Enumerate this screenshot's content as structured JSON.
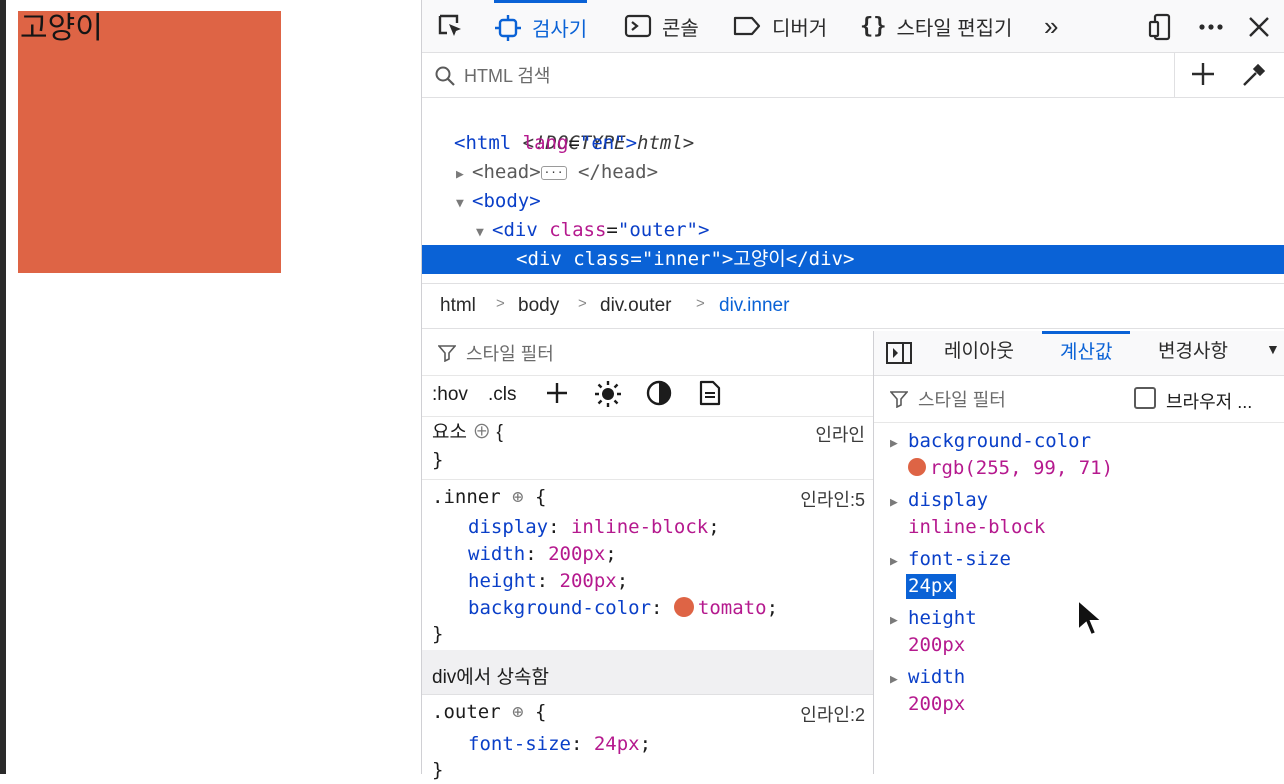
{
  "page": {
    "inner_text": "고양이",
    "inner_color": "#de6445"
  },
  "toolbar": {
    "tabs": [
      {
        "label": "검사기",
        "icon": "inspector-icon",
        "active": true
      },
      {
        "label": "콘솔",
        "icon": "console-icon"
      },
      {
        "label": "디버거",
        "icon": "debugger-icon"
      },
      {
        "label": "스타일 편집기",
        "icon": "style-editor-icon"
      }
    ],
    "more_tools": "»",
    "accent": "#0a62d6"
  },
  "search": {
    "placeholder": "HTML 검색"
  },
  "markup": {
    "doctype": "<!DOCTYPE html>",
    "html_open": "<html",
    "html_attr": "lang",
    "html_val": "\"en\"",
    "head_open": "<head>",
    "head_close": "</head>",
    "body_open": "<body>",
    "outer_div": "<div",
    "outer_attr": "class",
    "outer_val": "\"outer\"",
    "inner_line": "<div class=\"inner\">고양이</div>"
  },
  "breadcrumb": [
    "html",
    "body",
    "div.outer",
    "div.inner"
  ],
  "rules": {
    "filter_placeholder": "스타일 필터",
    "tools": [
      ":hov",
      ".cls"
    ],
    "element_rule": {
      "selector": "요소",
      "source": "인라인"
    },
    "inner_rule": {
      "selector": ".inner",
      "source": "인라인:5",
      "decls": [
        {
          "prop": "display",
          "value": "inline-block"
        },
        {
          "prop": "width",
          "value": "200px"
        },
        {
          "prop": "height",
          "value": "200px"
        },
        {
          "prop": "background-color",
          "value": "tomato"
        }
      ]
    },
    "inherited_header": "div에서 상속함",
    "outer_rule": {
      "selector": ".outer",
      "source": "인라인:2",
      "decls": [
        {
          "prop": "font-size",
          "value": "24px"
        }
      ]
    }
  },
  "side": {
    "tabs": [
      "레이아웃",
      "계산값",
      "변경사항"
    ],
    "active_tab": "계산값",
    "filter_placeholder": "스타일 필터",
    "browser_styles_label": "브라우저 ...",
    "computed": [
      {
        "name": "background-color",
        "value": "rgb(255, 99, 71)",
        "swatch": true
      },
      {
        "name": "display",
        "value": "inline-block"
      },
      {
        "name": "font-size",
        "value": "24px",
        "highlighted": true
      },
      {
        "name": "height",
        "value": "200px"
      },
      {
        "name": "width",
        "value": "200px"
      }
    ]
  }
}
